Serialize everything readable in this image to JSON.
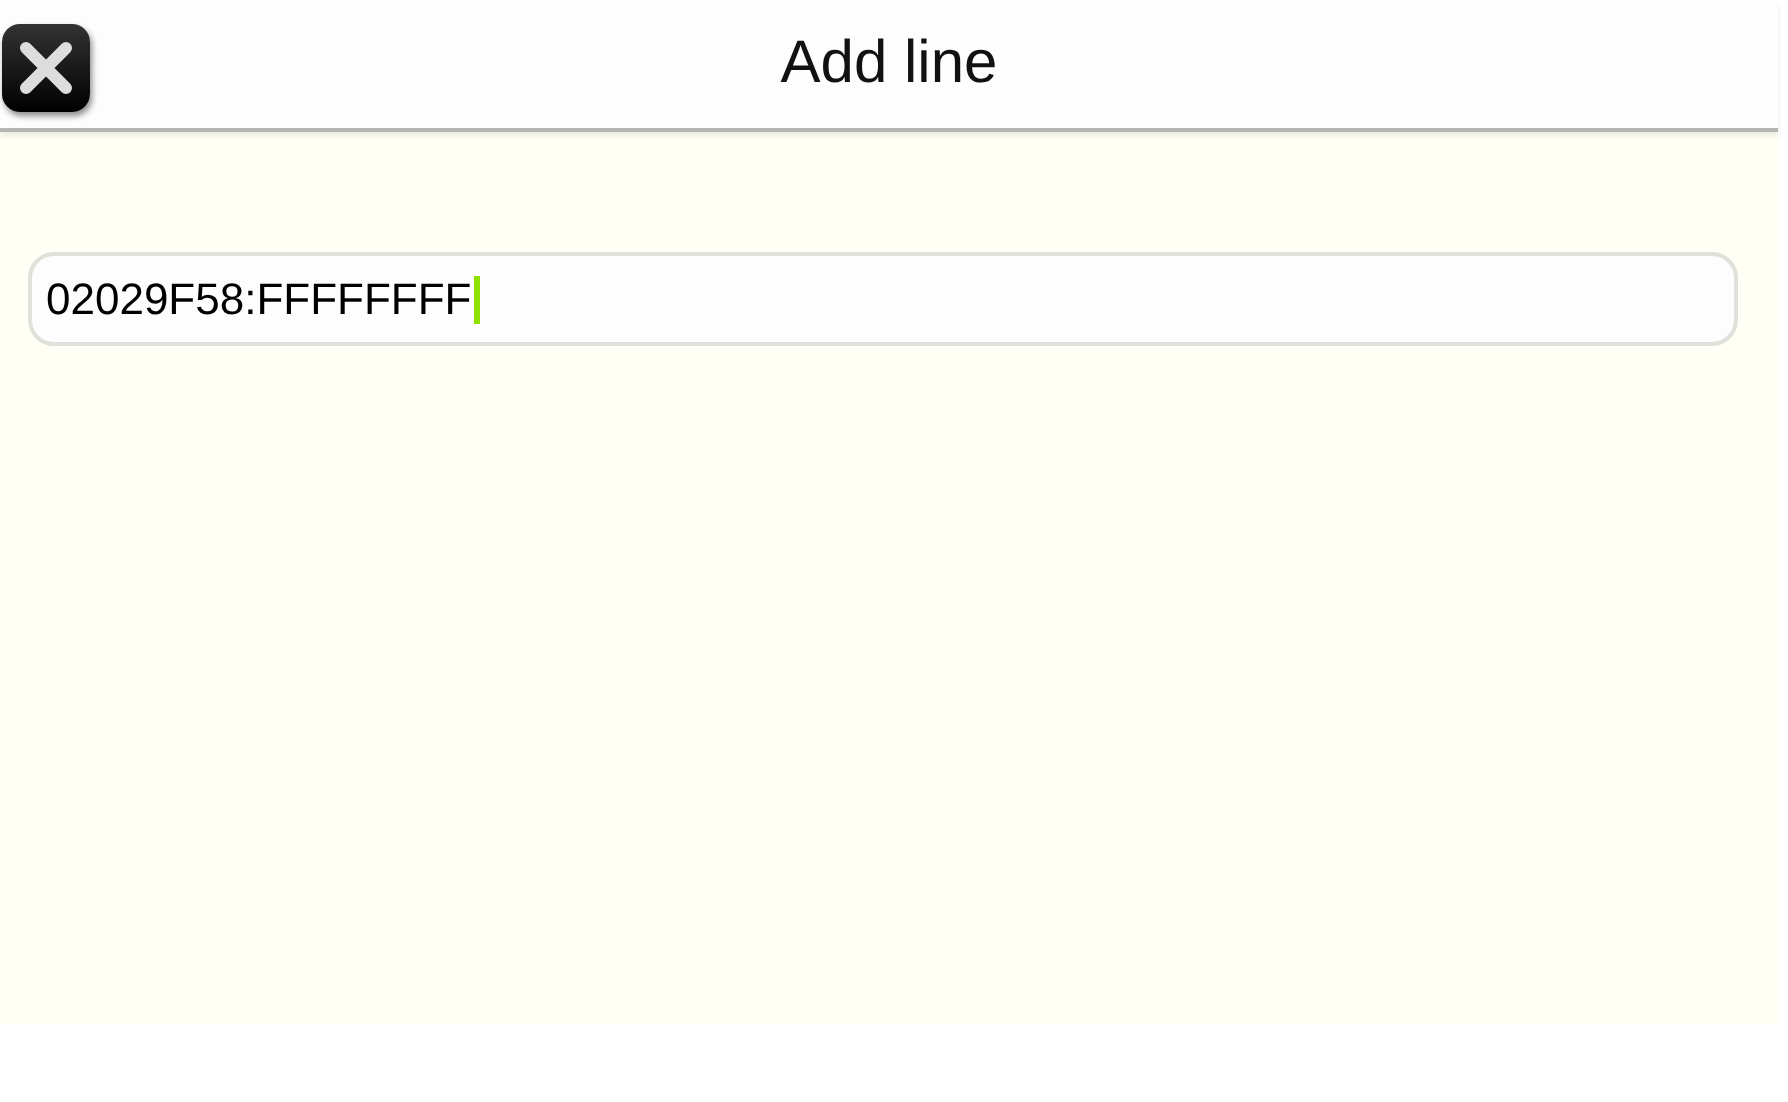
{
  "window": {
    "title": "Add line"
  },
  "field": {
    "value": "02029F58:FFFFFFFF",
    "focused": true
  }
}
